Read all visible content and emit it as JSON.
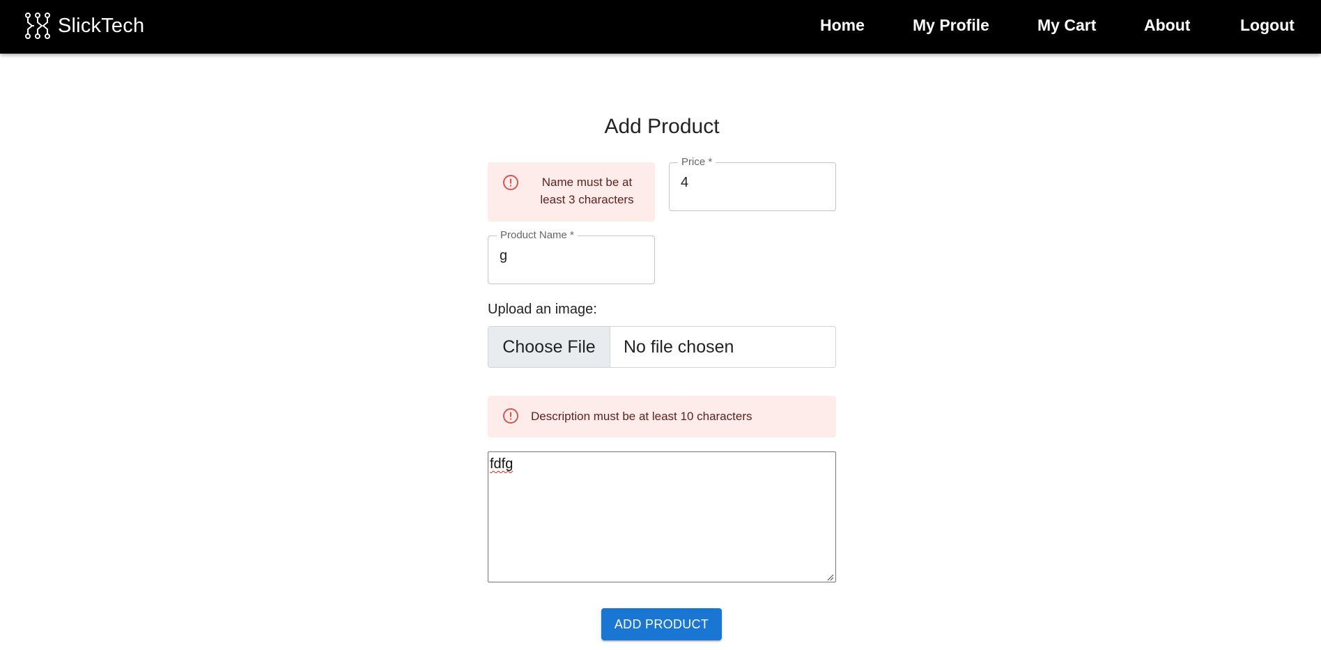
{
  "navbar": {
    "brand": "SlickTech",
    "brand_icon": "circuit-logo-icon",
    "items": [
      {
        "label": "Home"
      },
      {
        "label": "My Profile"
      },
      {
        "label": "My Cart"
      },
      {
        "label": "About"
      },
      {
        "label": "Logout"
      }
    ]
  },
  "form": {
    "title": "Add Product",
    "name_error": "Name must be at least 3 characters",
    "price": {
      "label": "Price *",
      "value": "4"
    },
    "product_name": {
      "label": "Product Name *",
      "value": "g"
    },
    "upload_label": "Upload an image:",
    "file_button": "Choose File",
    "file_status": "No file chosen",
    "description_error": "Description must be at least 10 characters",
    "description_value": "fdfg",
    "submit_label": "ADD PRODUCT"
  },
  "colors": {
    "navbar_bg": "#000000",
    "error_bg": "#fdecea",
    "error_icon": "#d9534f",
    "primary": "#1976d2"
  }
}
